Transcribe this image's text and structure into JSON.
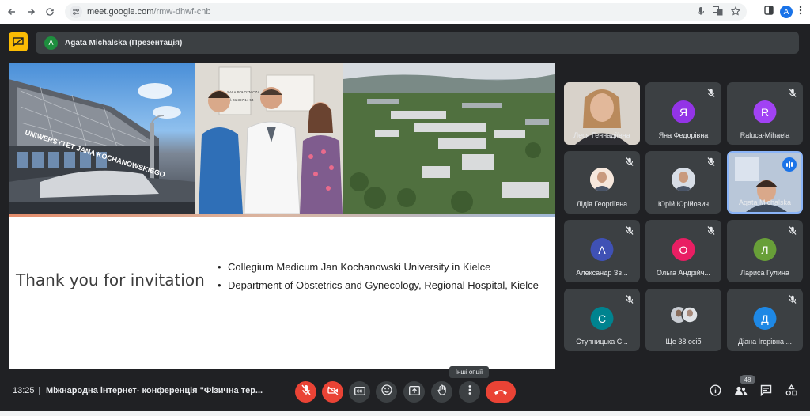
{
  "browser": {
    "url_host": "meet.google.com",
    "url_path": "/rmw-dhwf-cnb",
    "profile_initial": "A"
  },
  "presentation": {
    "presenter_initial": "A",
    "presenter_label": "Agata Michalska (Презентація)"
  },
  "slide": {
    "title": "Thank you for invitation",
    "bullets": [
      "Collegium Medicum Jan Kochanowski University in Kielce",
      "Department of Obstetrics and Gynecology, Regional Hospital, Kielce"
    ],
    "building_sign": "UNIWERSYTET JANA KOCHANOWSKIEGO",
    "door_sign_lines": [
      "SALA POŁOŻNICZA",
      "tel. 41 367 14 54"
    ]
  },
  "participants": [
    {
      "name": "Леся Геннадіївна",
      "initial": "",
      "color": "",
      "muted": false,
      "type": "video"
    },
    {
      "name": "Яна Федорівна",
      "initial": "Я",
      "color": "#9334e6",
      "muted": true,
      "type": "avatar"
    },
    {
      "name": "Raluca-Mihaela",
      "initial": "R",
      "color": "#a142f4",
      "muted": true,
      "type": "avatar"
    },
    {
      "name": "Лідія Георгіївна",
      "initial": "",
      "color": "#f6e7dc",
      "muted": true,
      "type": "photo"
    },
    {
      "name": "Юрій Юрійович",
      "initial": "",
      "color": "#d7dde6",
      "muted": true,
      "type": "photo"
    },
    {
      "name": "Agata Michalska",
      "initial": "",
      "color": "",
      "muted": false,
      "type": "video-speaking"
    },
    {
      "name": "Александр Зв...",
      "initial": "А",
      "color": "#3f51b5",
      "muted": true,
      "type": "avatar"
    },
    {
      "name": "Ольга Андрійч...",
      "initial": "О",
      "color": "#e91e63",
      "muted": true,
      "type": "avatar"
    },
    {
      "name": "Лариса Гулина",
      "initial": "Л",
      "color": "#689f38",
      "muted": true,
      "type": "avatar"
    },
    {
      "name": "Ступницька С...",
      "initial": "С",
      "color": "#00838f",
      "muted": true,
      "type": "avatar"
    },
    {
      "name": "Ще 38 осіб",
      "initial": "",
      "color": "",
      "muted": false,
      "type": "more"
    },
    {
      "name": "Діана Ігорівна ...",
      "initial": "Д",
      "color": "#1e88e5",
      "muted": true,
      "type": "avatar"
    }
  ],
  "bottom": {
    "time": "13:25",
    "separator": "|",
    "meeting_title": "Міжнародна інтернет- конференція \"Фізична тер...",
    "tooltip": "Інші опції",
    "participant_count": "48"
  },
  "colors": {
    "background": "#202124",
    "tile": "#3c4043",
    "danger": "#ea4335",
    "accent": "#1a73e8",
    "present_icon": "#fbbc04"
  },
  "icons": [
    "back-icon",
    "forward-icon",
    "reload-icon",
    "site-info-icon",
    "mic-icon",
    "translate-icon",
    "star-icon",
    "sidepanel-icon",
    "menu-dots-icon",
    "present-to-all-icon",
    "mic-off-icon",
    "camera-off-icon",
    "captions-icon",
    "emoji-icon",
    "present-icon",
    "raise-hand-icon",
    "more-options-icon",
    "hangup-icon",
    "info-icon",
    "people-icon",
    "chat-icon",
    "activities-icon"
  ]
}
